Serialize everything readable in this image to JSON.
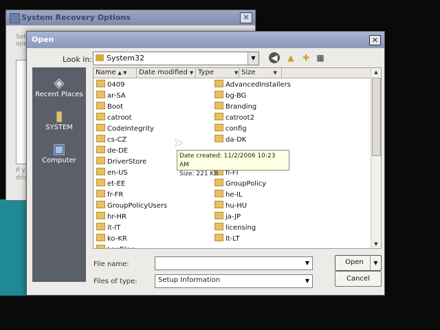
{
  "background_dialog": {
    "title": "System Recovery Options",
    "close_glyph": "✕",
    "select_text": "Sele\nope",
    "if_text": "If y\ndriv"
  },
  "dialog": {
    "title": "Open",
    "close_glyph": "✕",
    "look_in_label": "Look in:",
    "look_in_value": "System32",
    "toolbar_icons": [
      "back-icon",
      "up-folder-icon",
      "new-folder-icon",
      "views-icon"
    ],
    "places": [
      {
        "label": "Recent Places",
        "icon": "recent-places-icon"
      },
      {
        "label": "SYSTEM",
        "icon": "user-icon"
      },
      {
        "label": "Computer",
        "icon": "computer-icon"
      }
    ],
    "columns": [
      "Name",
      "Date modified",
      "Type",
      "Size"
    ],
    "left_items": [
      "0409",
      "ar-SA",
      "Boot",
      "catroot",
      "CodeIntegrity",
      "cs-CZ",
      "de-DE",
      "DriverStore",
      "en-US",
      "et-EE",
      "fr-FR",
      "GroupPolicyUsers",
      "hr-HR",
      "it-IT",
      "ko-KR",
      "LogFiles"
    ],
    "right_items": [
      "AdvancedInstallers",
      "bg-BG",
      "Branding",
      "catroot2",
      "config",
      "da-DK",
      "",
      "",
      "fi-FI",
      "GroupPolicy",
      "he-IL",
      "hu-HU",
      "ja-JP",
      "licensing",
      "lt-LT"
    ],
    "tooltip": {
      "date_created": "Date created: 11/2/2006 10:23 AM",
      "size": "Size: 221 KB"
    },
    "file_name_label": "File name:",
    "file_name_value": "",
    "files_of_type_label": "Files of type:",
    "files_of_type_value": "Setup Information",
    "open_button": "Open",
    "cancel_button": "Cancel"
  },
  "colors": {
    "title_bar": "#8b98bd",
    "places_bar": "#5a5f6a",
    "folder": "#e7c063",
    "desktop": "#1f8a96"
  }
}
